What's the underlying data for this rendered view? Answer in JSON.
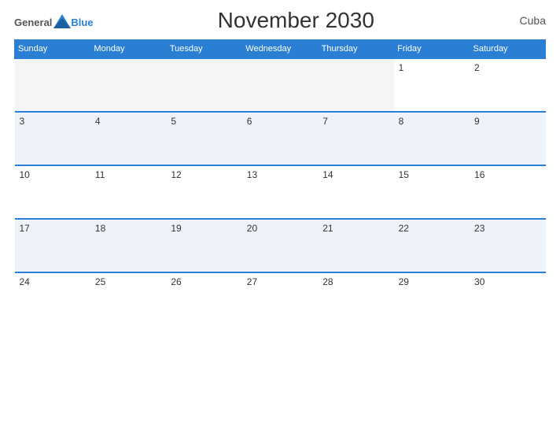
{
  "header": {
    "logo_general": "General",
    "logo_blue": "Blue",
    "title": "November 2030",
    "country": "Cuba"
  },
  "calendar": {
    "days_of_week": [
      "Sunday",
      "Monday",
      "Tuesday",
      "Wednesday",
      "Thursday",
      "Friday",
      "Saturday"
    ],
    "weeks": [
      [
        {
          "day": "",
          "empty": true
        },
        {
          "day": "",
          "empty": true
        },
        {
          "day": "",
          "empty": true
        },
        {
          "day": "",
          "empty": true
        },
        {
          "day": "",
          "empty": true
        },
        {
          "day": "1",
          "empty": false
        },
        {
          "day": "2",
          "empty": false
        }
      ],
      [
        {
          "day": "3",
          "empty": false
        },
        {
          "day": "4",
          "empty": false
        },
        {
          "day": "5",
          "empty": false
        },
        {
          "day": "6",
          "empty": false
        },
        {
          "day": "7",
          "empty": false
        },
        {
          "day": "8",
          "empty": false
        },
        {
          "day": "9",
          "empty": false
        }
      ],
      [
        {
          "day": "10",
          "empty": false
        },
        {
          "day": "11",
          "empty": false
        },
        {
          "day": "12",
          "empty": false
        },
        {
          "day": "13",
          "empty": false
        },
        {
          "day": "14",
          "empty": false
        },
        {
          "day": "15",
          "empty": false
        },
        {
          "day": "16",
          "empty": false
        }
      ],
      [
        {
          "day": "17",
          "empty": false
        },
        {
          "day": "18",
          "empty": false
        },
        {
          "day": "19",
          "empty": false
        },
        {
          "day": "20",
          "empty": false
        },
        {
          "day": "21",
          "empty": false
        },
        {
          "day": "22",
          "empty": false
        },
        {
          "day": "23",
          "empty": false
        }
      ],
      [
        {
          "day": "24",
          "empty": false
        },
        {
          "day": "25",
          "empty": false
        },
        {
          "day": "26",
          "empty": false
        },
        {
          "day": "27",
          "empty": false
        },
        {
          "day": "28",
          "empty": false
        },
        {
          "day": "29",
          "empty": false
        },
        {
          "day": "30",
          "empty": false
        }
      ]
    ]
  }
}
